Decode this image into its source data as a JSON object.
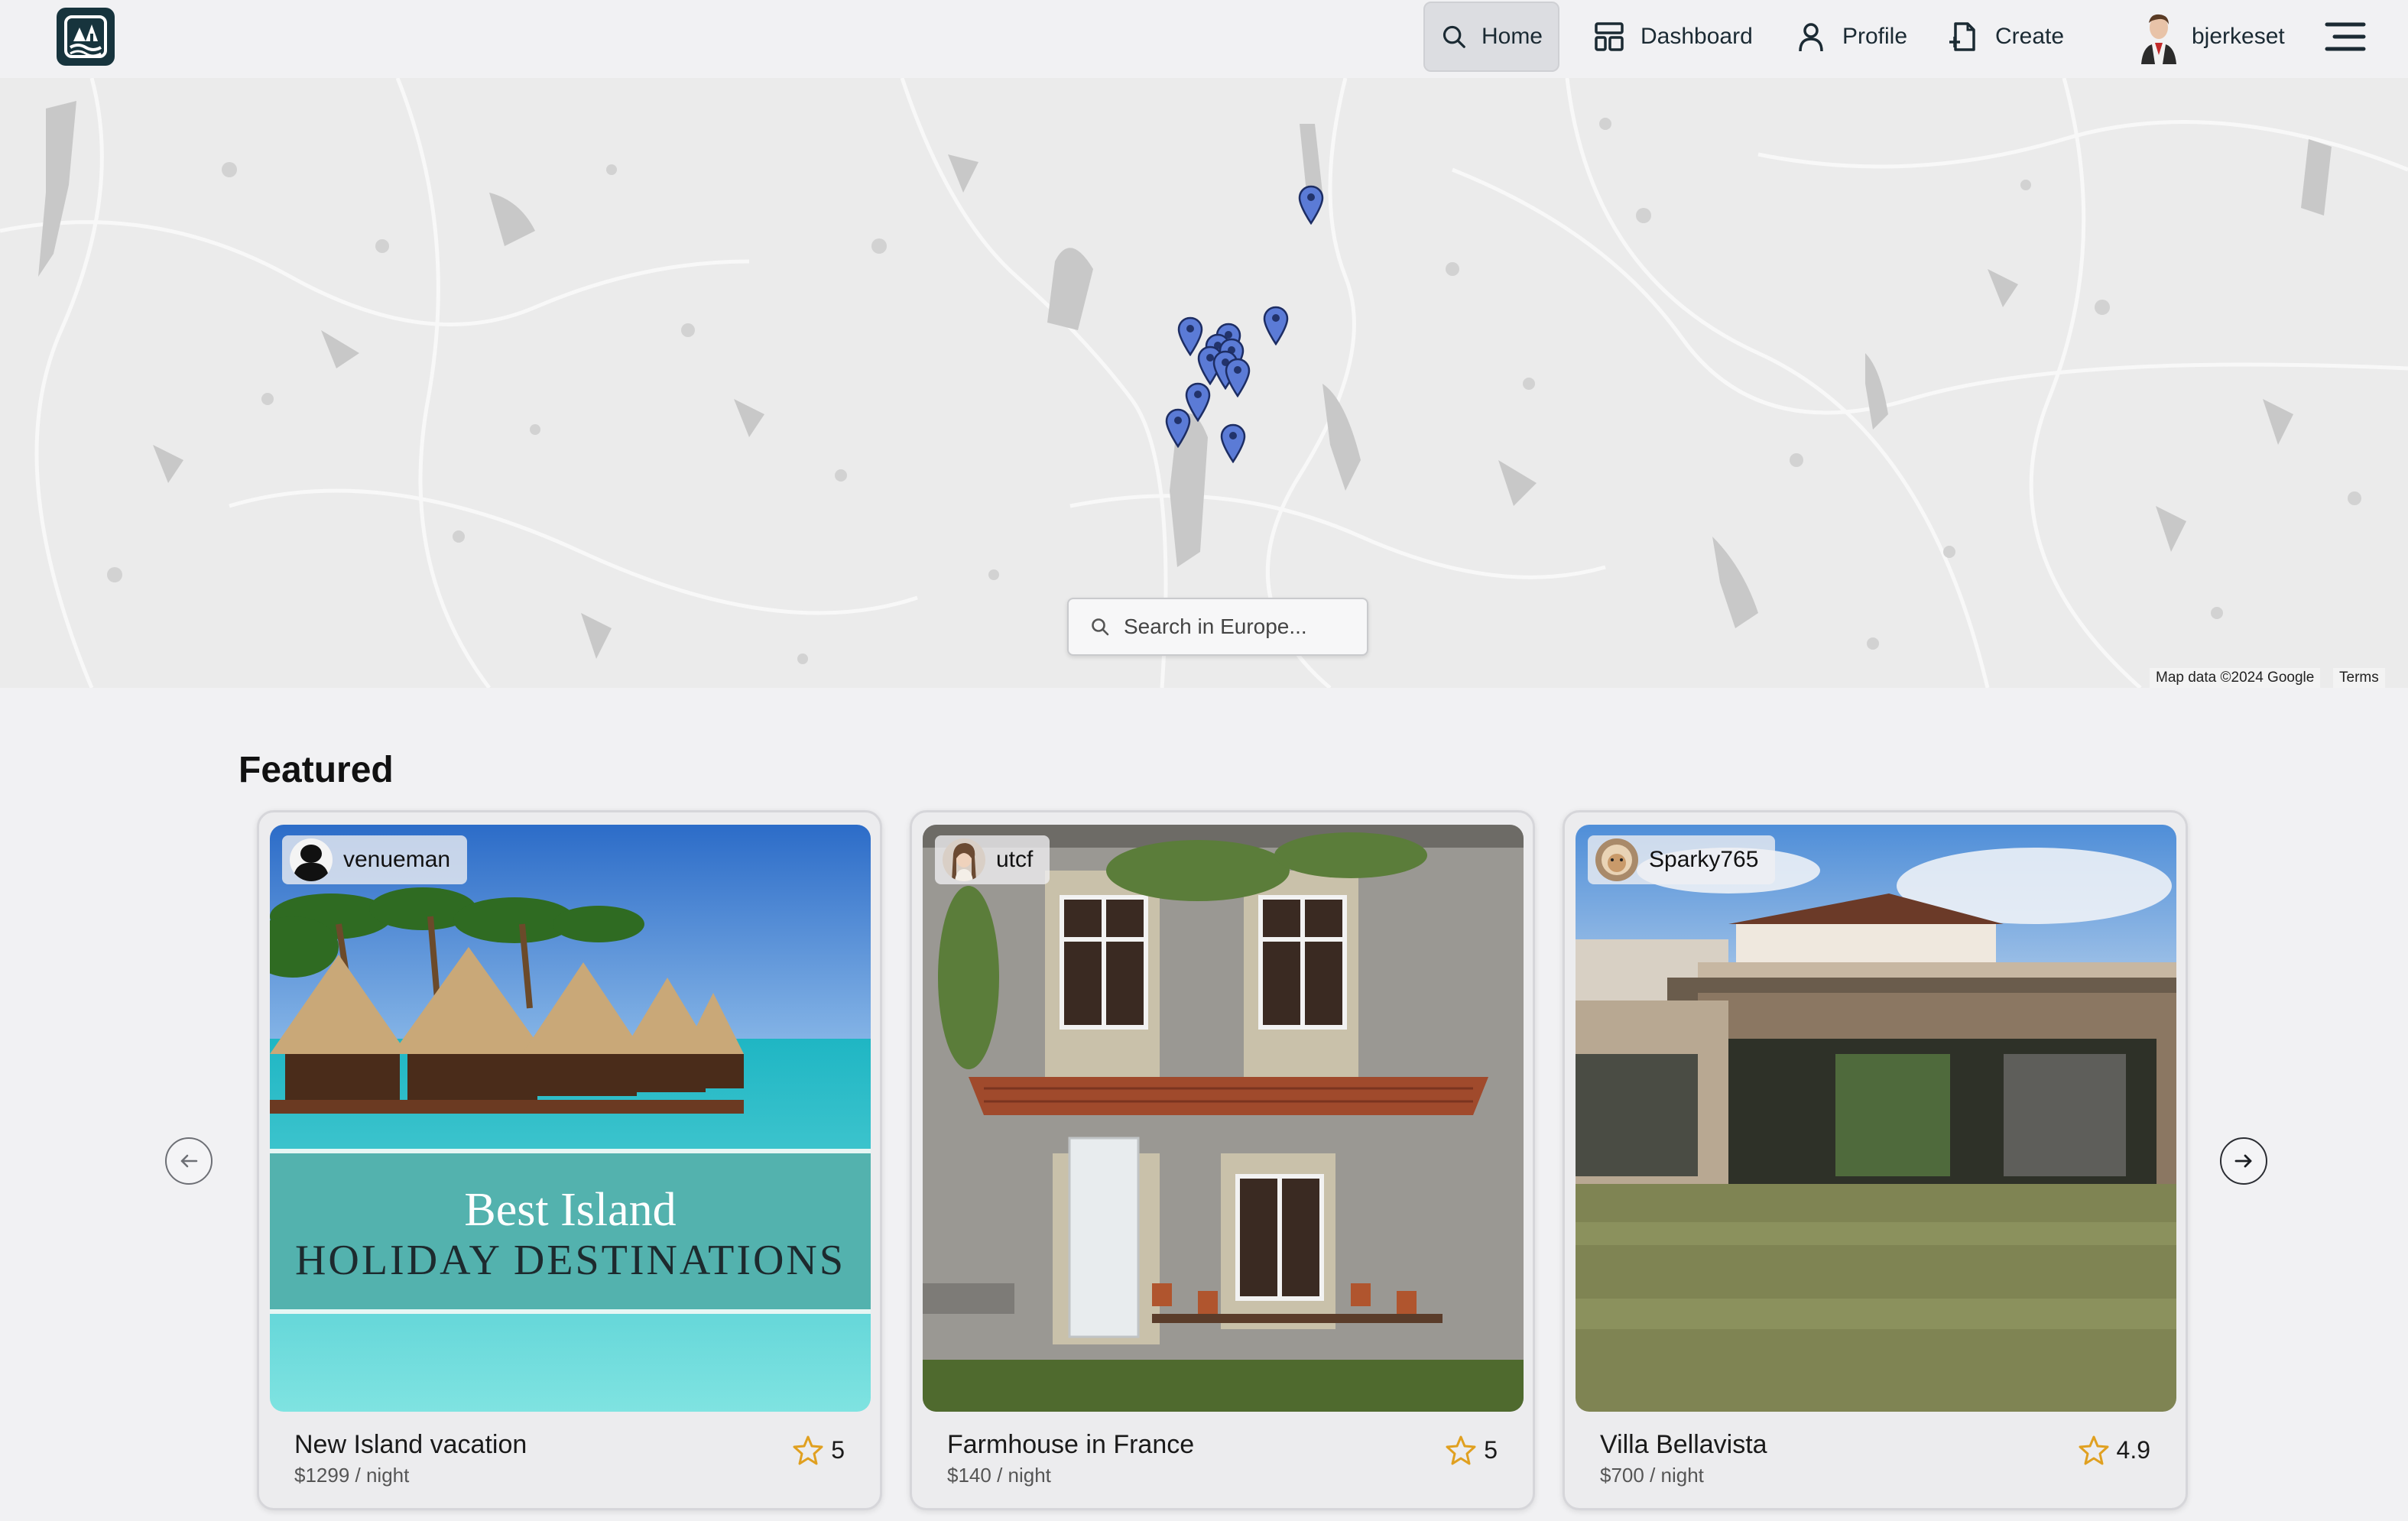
{
  "nav": {
    "home": "Home",
    "dashboard": "Dashboard",
    "profile": "Profile",
    "create": "Create",
    "username": "bjerkeset",
    "logo_icon": "island-logo-icon",
    "menu_icon": "hamburger-menu-icon"
  },
  "map": {
    "search_placeholder": "Search in Europe...",
    "attribution": "Map data ©2024 Google",
    "terms": "Terms",
    "pin_count": 12
  },
  "featured": {
    "title": "Featured",
    "prev_icon": "arrow-left-icon",
    "next_icon": "arrow-right-icon",
    "cards": [
      {
        "owner": "venueman",
        "title": "New Island vacation",
        "price": "$1299 / night",
        "rating": "5",
        "image_text_line1": "Best Island",
        "image_text_line2": "HOLIDAY DESTINATIONS"
      },
      {
        "owner": "utcf",
        "title": "Farmhouse in France",
        "price": "$140 / night",
        "rating": "5"
      },
      {
        "owner": "Sparky765",
        "title": "Villa Bellavista",
        "price": "$700 / night",
        "rating": "4.9"
      }
    ]
  },
  "colors": {
    "accent": "#17343d",
    "pin": "#5b7bd6",
    "star": "#e0a020",
    "background": "#f1f1f3"
  }
}
